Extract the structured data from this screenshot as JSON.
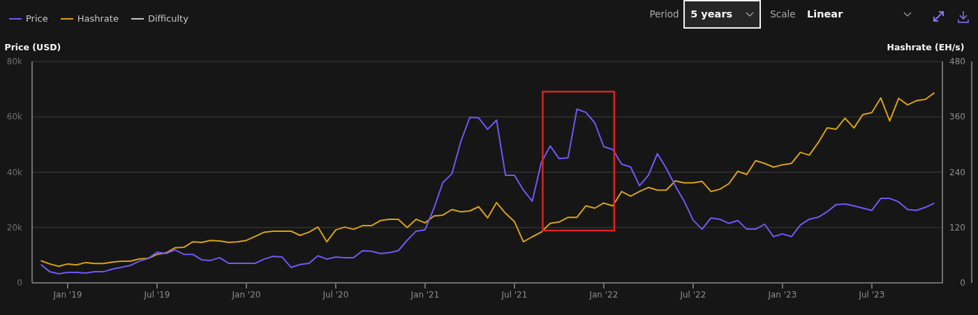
{
  "legend_extra": [
    {
      "label": "Difficulty",
      "color": "#c6c6c6"
    }
  ],
  "controls": {
    "period": {
      "label": "Period",
      "value": "5 years",
      "focused": true
    },
    "scale": {
      "label": "Scale",
      "value": "Linear",
      "focused": false
    }
  },
  "chart": {
    "highlighted": true,
    "chart_data": {
      "type": "line",
      "grid": true,
      "ylabel": "Price (USD)",
      "y2label": "Hashrate (EH/s)",
      "ylim": [
        0,
        80000
      ],
      "y2lim": [
        0,
        480
      ],
      "categories": [
        null,
        null,
        null,
        "Jan '19",
        null,
        null,
        null,
        null,
        null,
        null,
        null,
        null,
        null,
        "Jul '19",
        null,
        null,
        null,
        null,
        null,
        null,
        null,
        null,
        null,
        "Jan '20",
        null,
        null,
        null,
        null,
        null,
        null,
        null,
        null,
        null,
        "Jul '20",
        null,
        null,
        null,
        null,
        null,
        null,
        null,
        null,
        null,
        "Jan '21",
        null,
        null,
        null,
        null,
        null,
        null,
        null,
        null,
        null,
        "Jul '21",
        null,
        null,
        null,
        null,
        null,
        null,
        null,
        null,
        null,
        "Jan '22",
        null,
        null,
        null,
        null,
        null,
        null,
        null,
        null,
        null,
        "Jul '22",
        null,
        null,
        null,
        null,
        null,
        null,
        null,
        null,
        null,
        "Jan '23",
        null,
        null,
        null,
        null,
        null,
        null,
        null,
        null,
        null,
        "Jul '23",
        null,
        null,
        null,
        null,
        null,
        null,
        null
      ],
      "yticks": [
        {
          "value": 0,
          "label": "0"
        },
        {
          "value": 20000,
          "label": "20k"
        },
        {
          "value": 40000,
          "label": "40k"
        },
        {
          "value": 60000,
          "label": "60k"
        },
        {
          "value": 80000,
          "label": "80k"
        }
      ],
      "y2ticks": [
        {
          "value": 0,
          "label": "0"
        },
        {
          "value": 120,
          "label": "120"
        },
        {
          "value": 240,
          "label": "240"
        },
        {
          "value": 360,
          "label": "360"
        },
        {
          "value": 480,
          "label": "480"
        }
      ],
      "series": [
        {
          "name": "Price",
          "color": "#7158f5",
          "axis": "y",
          "values": [
            6600,
            4000,
            3300,
            3800,
            3800,
            3500,
            4000,
            4000,
            5000,
            5600,
            6300,
            7800,
            8800,
            11100,
            10600,
            11900,
            10300,
            10300,
            8300,
            8100,
            9100,
            7100,
            7100,
            7100,
            7100,
            8600,
            9600,
            9300,
            5600,
            6600,
            7100,
            9800,
            8600,
            9300,
            9100,
            9100,
            11600,
            11400,
            10600,
            10900,
            11600,
            15400,
            18700,
            19200,
            27000,
            36300,
            39400,
            51000,
            59800,
            59600,
            55500,
            58800,
            38900,
            38900,
            33600,
            29500,
            43400,
            49500,
            44900,
            45200,
            62800,
            61600,
            57800,
            49200,
            48200,
            42900,
            41900,
            35100,
            38900,
            46700,
            41400,
            35100,
            29500,
            22700,
            19400,
            23500,
            23000,
            21500,
            22500,
            19400,
            19400,
            21200,
            16700,
            17700,
            16700,
            20900,
            23000,
            23700,
            25700,
            28300,
            28500,
            27800,
            27000,
            26200,
            30500,
            30500,
            29300,
            26500,
            26200,
            27300,
            28800
          ]
        },
        {
          "name": "Hashrate",
          "color": "#d9a30f",
          "axis": "y2",
          "values": [
            48,
            41,
            36,
            41,
            39,
            44,
            42,
            42,
            45,
            47,
            47,
            52,
            53,
            62,
            65,
            76,
            77,
            89,
            88,
            92,
            91,
            88,
            89,
            92,
            101,
            110,
            112,
            112,
            112,
            103,
            110,
            121,
            89,
            115,
            121,
            116,
            124,
            124,
            135,
            138,
            138,
            120,
            138,
            130,
            145,
            147,
            159,
            154,
            156,
            165,
            141,
            174,
            151,
            133,
            89,
            100,
            110,
            129,
            132,
            142,
            142,
            167,
            162,
            173,
            167,
            198,
            188,
            198,
            207,
            201,
            201,
            221,
            217,
            217,
            220,
            198,
            203,
            215,
            242,
            235,
            265,
            259,
            251,
            256,
            259,
            283,
            277,
            304,
            336,
            333,
            357,
            336,
            365,
            369,
            401,
            351,
            400,
            386,
            395,
            398,
            412
          ]
        }
      ]
    }
  }
}
